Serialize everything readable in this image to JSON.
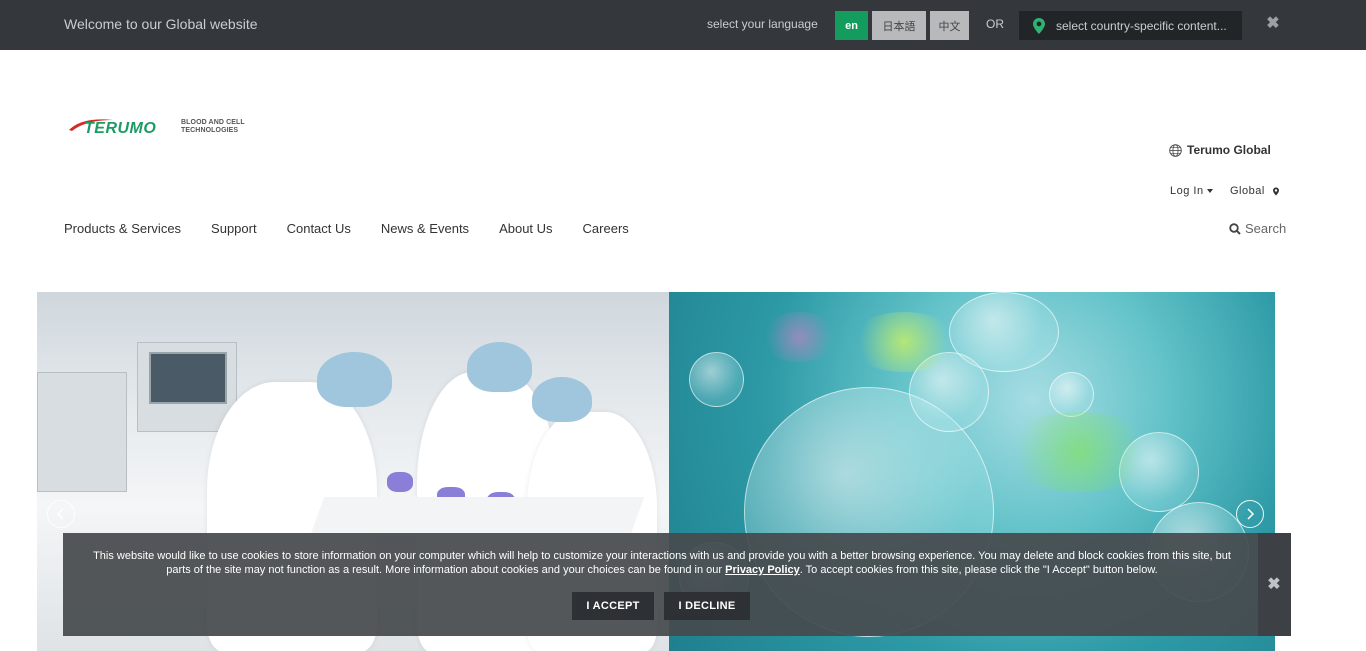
{
  "topbar": {
    "welcome": "Welcome to our Global website",
    "lang_label": "select your language",
    "languages": [
      "en",
      "日本語",
      "中文"
    ],
    "or": "OR",
    "country_placeholder": "select country-specific content...",
    "close": "✖"
  },
  "logo": {
    "brand": "TERUMO",
    "tagline_line1": "BLOOD AND CELL",
    "tagline_line2": "TECHNOLOGIES"
  },
  "utility": {
    "terumo_global": "Terumo Global",
    "login": "Log In",
    "region": "Global"
  },
  "nav": {
    "items": [
      "Products & Services",
      "Support",
      "Contact Us",
      "News & Events",
      "About Us",
      "Careers"
    ],
    "search": "Search"
  },
  "cookie": {
    "message_part1": "This website would like to use cookies to store information on your computer which will help to customize your interactions with us and provide you with a better browsing experience. You may delete and block cookies from this site, but parts of the site may not function as a result. More information about cookies and your choices can be found in our ",
    "privacy_link": "Privacy Policy",
    "message_part2": ". To accept cookies from this site, please click the \"I Accept\" button below.",
    "accept": "I ACCEPT",
    "decline": "I DECLINE",
    "close": "✖"
  },
  "colors": {
    "topbar_bg": "#34383c",
    "accent_green": "#149c5f",
    "brand_green": "#1e9a63",
    "brand_red": "#d42a2a"
  }
}
